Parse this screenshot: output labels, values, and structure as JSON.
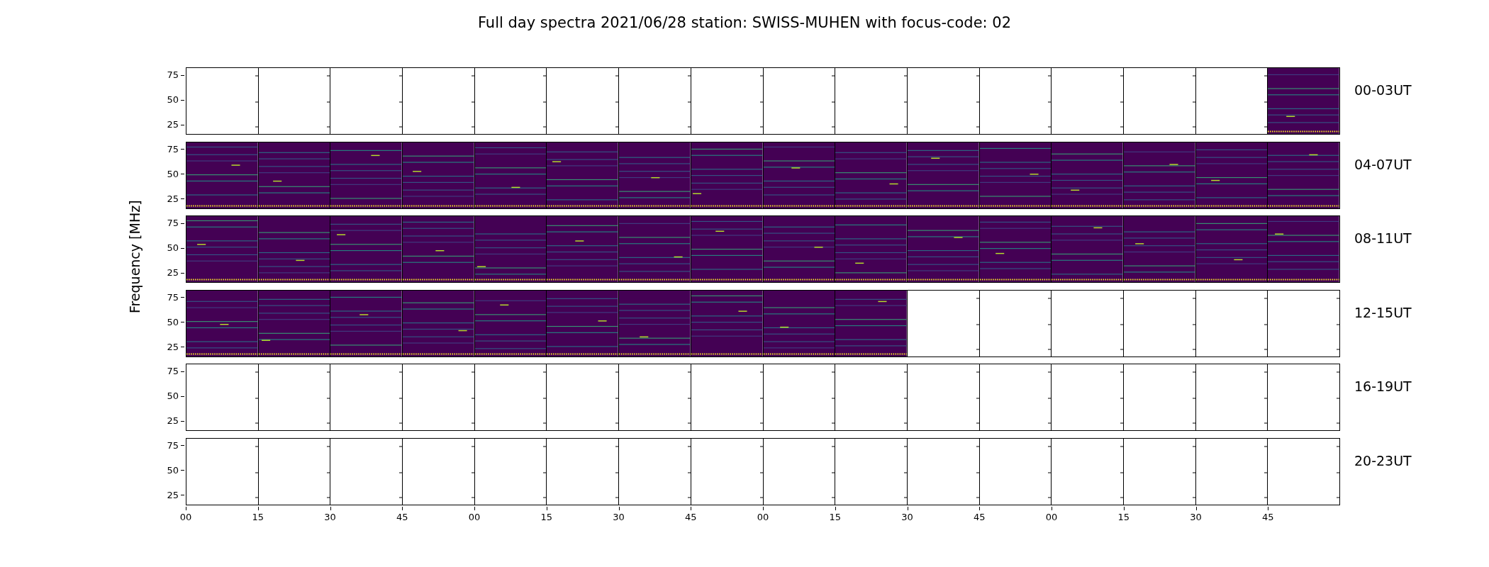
{
  "title": "Full day spectra 2021/06/28 station: SWISS-MUHEN with focus-code: 02",
  "ylabel": "Frequency [MHz]",
  "rows": [
    {
      "label": "00-03UT",
      "yticks": [
        "75",
        "50",
        "25"
      ],
      "panels": [
        {
          "filled": false
        },
        {
          "filled": false
        },
        {
          "filled": false
        },
        {
          "filled": false
        },
        {
          "filled": false
        },
        {
          "filled": false
        },
        {
          "filled": false
        },
        {
          "filled": false
        },
        {
          "filled": false
        },
        {
          "filled": false
        },
        {
          "filled": false
        },
        {
          "filled": false
        },
        {
          "filled": false
        },
        {
          "filled": false
        },
        {
          "filled": false
        },
        {
          "filled": true
        }
      ]
    },
    {
      "label": "04-07UT",
      "yticks": [
        "75",
        "50",
        "25"
      ],
      "panels": [
        {
          "filled": true
        },
        {
          "filled": true
        },
        {
          "filled": true
        },
        {
          "filled": true
        },
        {
          "filled": true
        },
        {
          "filled": true
        },
        {
          "filled": true
        },
        {
          "filled": true
        },
        {
          "filled": true
        },
        {
          "filled": true
        },
        {
          "filled": true
        },
        {
          "filled": true
        },
        {
          "filled": true
        },
        {
          "filled": true
        },
        {
          "filled": true
        },
        {
          "filled": true
        }
      ]
    },
    {
      "label": "08-11UT",
      "yticks": [
        "75",
        "50",
        "25"
      ],
      "panels": [
        {
          "filled": true
        },
        {
          "filled": true
        },
        {
          "filled": true
        },
        {
          "filled": true
        },
        {
          "filled": true
        },
        {
          "filled": true
        },
        {
          "filled": true
        },
        {
          "filled": true
        },
        {
          "filled": true
        },
        {
          "filled": true
        },
        {
          "filled": true
        },
        {
          "filled": true
        },
        {
          "filled": true
        },
        {
          "filled": true
        },
        {
          "filled": true
        },
        {
          "filled": true
        }
      ]
    },
    {
      "label": "12-15UT",
      "yticks": [
        "75",
        "50",
        "25"
      ],
      "panels": [
        {
          "filled": true
        },
        {
          "filled": true
        },
        {
          "filled": true
        },
        {
          "filled": true
        },
        {
          "filled": true
        },
        {
          "filled": true
        },
        {
          "filled": true
        },
        {
          "filled": true
        },
        {
          "filled": true
        },
        {
          "filled": true
        },
        {
          "filled": false
        },
        {
          "filled": false
        },
        {
          "filled": false
        },
        {
          "filled": false
        },
        {
          "filled": false
        },
        {
          "filled": false
        }
      ]
    },
    {
      "label": "16-19UT",
      "yticks": [
        "75",
        "50",
        "25"
      ],
      "panels": [
        {
          "filled": false
        },
        {
          "filled": false
        },
        {
          "filled": false
        },
        {
          "filled": false
        },
        {
          "filled": false
        },
        {
          "filled": false
        },
        {
          "filled": false
        },
        {
          "filled": false
        },
        {
          "filled": false
        },
        {
          "filled": false
        },
        {
          "filled": false
        },
        {
          "filled": false
        },
        {
          "filled": false
        },
        {
          "filled": false
        },
        {
          "filled": false
        },
        {
          "filled": false
        }
      ]
    },
    {
      "label": "20-23UT",
      "yticks": [
        "75",
        "50",
        "25"
      ],
      "panels": [
        {
          "filled": false
        },
        {
          "filled": false
        },
        {
          "filled": false
        },
        {
          "filled": false
        },
        {
          "filled": false
        },
        {
          "filled": false
        },
        {
          "filled": false
        },
        {
          "filled": false
        },
        {
          "filled": false
        },
        {
          "filled": false
        },
        {
          "filled": false
        },
        {
          "filled": false
        },
        {
          "filled": false
        },
        {
          "filled": false
        },
        {
          "filled": false
        },
        {
          "filled": false
        }
      ]
    }
  ],
  "xticks": [
    "00",
    "15",
    "30",
    "45",
    "00",
    "15",
    "30",
    "45",
    "00",
    "15",
    "30",
    "45",
    "00",
    "15",
    "30",
    "45"
  ]
}
